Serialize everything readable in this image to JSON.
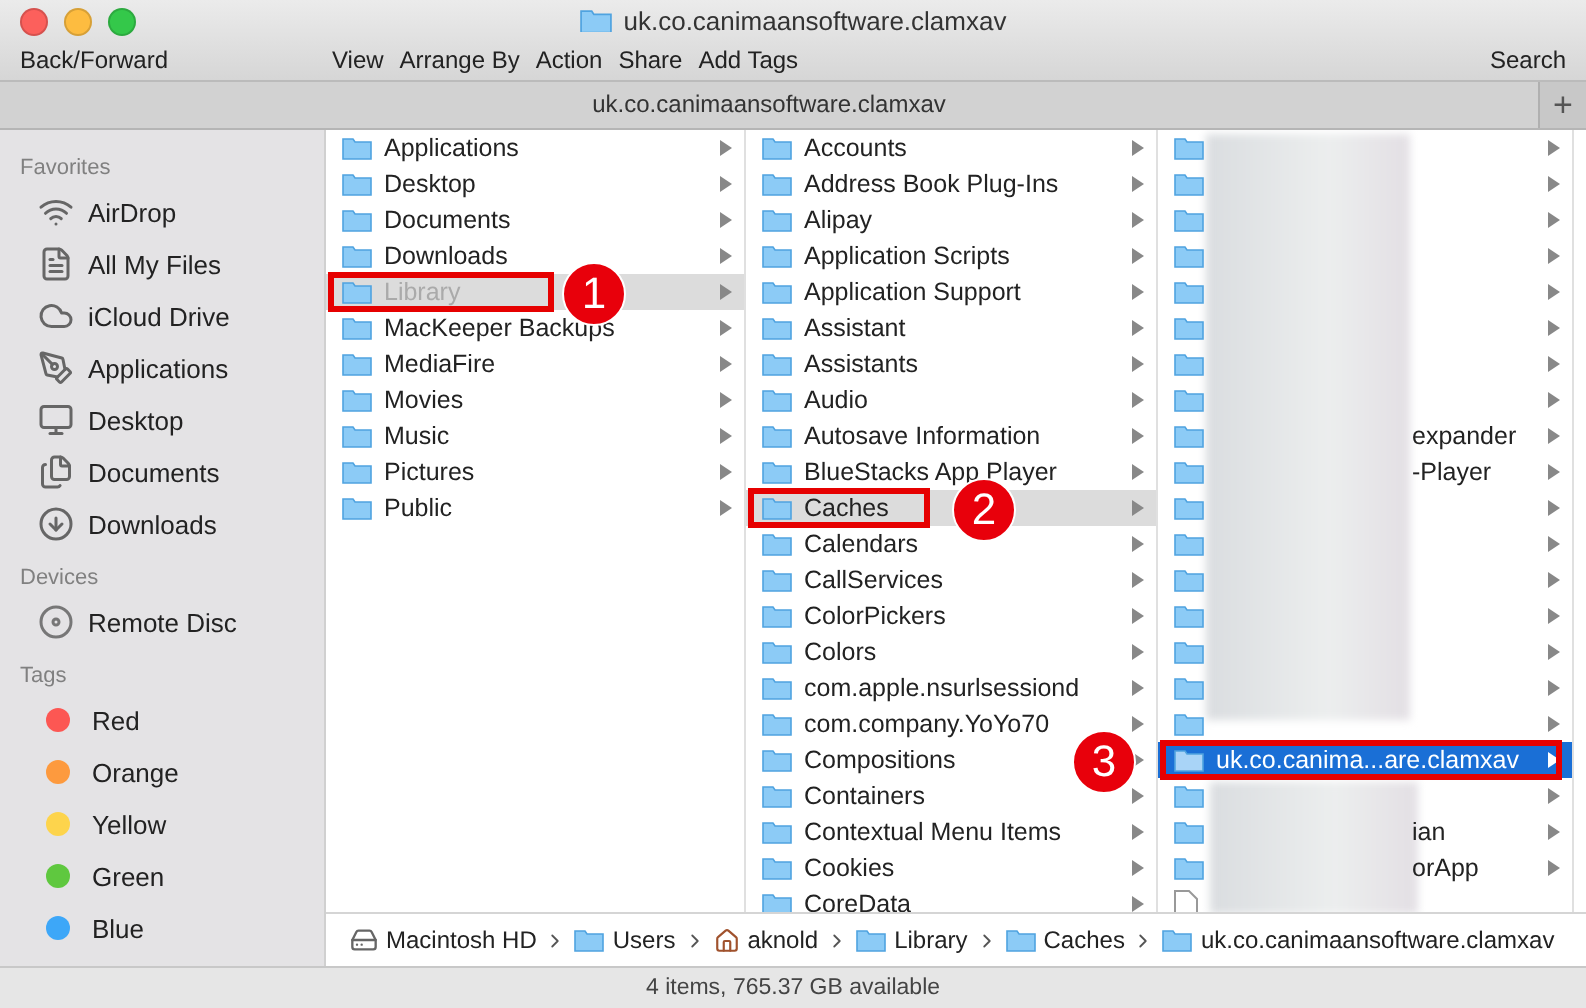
{
  "window": {
    "title": "uk.co.canimaansoftware.clamxav"
  },
  "toolbar": {
    "left": "Back/Forward",
    "items": [
      "View",
      "Arrange By",
      "Action",
      "Share",
      "Add Tags"
    ],
    "right": "Search"
  },
  "tab": {
    "title": "uk.co.canimaansoftware.clamxav",
    "add": "+"
  },
  "sidebar": [
    {
      "heading": "Favorites",
      "items": [
        {
          "kind": "place",
          "label": "AirDrop"
        },
        {
          "kind": "place",
          "label": "All My Files"
        },
        {
          "kind": "place",
          "label": "iCloud Drive"
        },
        {
          "kind": "place",
          "label": "Applications"
        },
        {
          "kind": "place",
          "label": "Desktop"
        },
        {
          "kind": "place",
          "label": "Documents"
        },
        {
          "kind": "place",
          "label": "Downloads"
        }
      ]
    },
    {
      "heading": "Devices",
      "items": [
        {
          "kind": "disc",
          "label": "Remote Disc"
        }
      ]
    },
    {
      "heading": "Tags",
      "items": [
        {
          "kind": "tag",
          "label": "Red",
          "color": "#fc5753"
        },
        {
          "kind": "tag",
          "label": "Orange",
          "color": "#fd9a3e"
        },
        {
          "kind": "tag",
          "label": "Yellow",
          "color": "#fdd44c"
        },
        {
          "kind": "tag",
          "label": "Green",
          "color": "#5fc83f"
        },
        {
          "kind": "tag",
          "label": "Blue",
          "color": "#3da7f8"
        }
      ]
    }
  ],
  "columns": [
    {
      "focused": false,
      "items": [
        {
          "name": "Applications",
          "selected": false
        },
        {
          "name": "Desktop",
          "selected": false
        },
        {
          "name": "Documents",
          "selected": false
        },
        {
          "name": "Downloads",
          "selected": false
        },
        {
          "name": "Library",
          "selected": true,
          "dimmed": true,
          "callout": "1"
        },
        {
          "name": "MacKeeper Backups",
          "selected": false
        },
        {
          "name": "MediaFire",
          "selected": false
        },
        {
          "name": "Movies",
          "selected": false
        },
        {
          "name": "Music",
          "selected": false
        },
        {
          "name": "Pictures",
          "selected": false
        },
        {
          "name": "Public",
          "selected": false
        }
      ]
    },
    {
      "focused": false,
      "items": [
        {
          "name": "Accounts",
          "selected": false
        },
        {
          "name": "Address Book Plug-Ins",
          "selected": false
        },
        {
          "name": "Alipay",
          "selected": false
        },
        {
          "name": "Application Scripts",
          "selected": false
        },
        {
          "name": "Application Support",
          "selected": false
        },
        {
          "name": "Assistant",
          "selected": false
        },
        {
          "name": "Assistants",
          "selected": false
        },
        {
          "name": "Audio",
          "selected": false
        },
        {
          "name": "Autosave Information",
          "selected": false
        },
        {
          "name": "BlueStacks App Player",
          "selected": false
        },
        {
          "name": "Caches",
          "selected": true,
          "callout": "2"
        },
        {
          "name": "Calendars",
          "selected": false
        },
        {
          "name": "CallServices",
          "selected": false
        },
        {
          "name": "ColorPickers",
          "selected": false
        },
        {
          "name": "Colors",
          "selected": false
        },
        {
          "name": "com.apple.nsurlsessiond",
          "selected": false
        },
        {
          "name": "com.company.YoYo70",
          "selected": false
        },
        {
          "name": "Compositions",
          "selected": false
        },
        {
          "name": "Containers",
          "selected": false
        },
        {
          "name": "Contextual Menu Items",
          "selected": false
        },
        {
          "name": "Cookies",
          "selected": false
        },
        {
          "name": "CoreData",
          "selected": false
        }
      ]
    },
    {
      "focused": true,
      "items": [
        {
          "selected": false
        },
        {
          "selected": false
        },
        {
          "selected": false
        },
        {
          "selected": false
        },
        {
          "selected": false
        },
        {
          "selected": false
        },
        {
          "selected": false
        },
        {
          "selected": false
        },
        {
          "fragment": "expander",
          "selected": false
        },
        {
          "fragment": "-Player",
          "selected": false
        },
        {
          "selected": false
        },
        {
          "selected": false
        },
        {
          "selected": false
        },
        {
          "selected": false
        },
        {
          "selected": false
        },
        {
          "selected": false
        },
        {
          "selected": false
        },
        {
          "name": "uk.co.canima...are.clamxav",
          "selected": true,
          "callout": "3"
        },
        {
          "selected": false
        },
        {
          "fragment": "ian",
          "selected": false
        },
        {
          "fragment": "orApp",
          "selected": false
        },
        {
          "kind": "file",
          "selected": false
        }
      ]
    }
  ],
  "path_bar": [
    "Macintosh HD",
    "Users",
    "aknold",
    "Library",
    "Caches",
    "uk.co.canimaansoftware.clamxav"
  ],
  "status_bar": "4 items, 765.37 GB available"
}
